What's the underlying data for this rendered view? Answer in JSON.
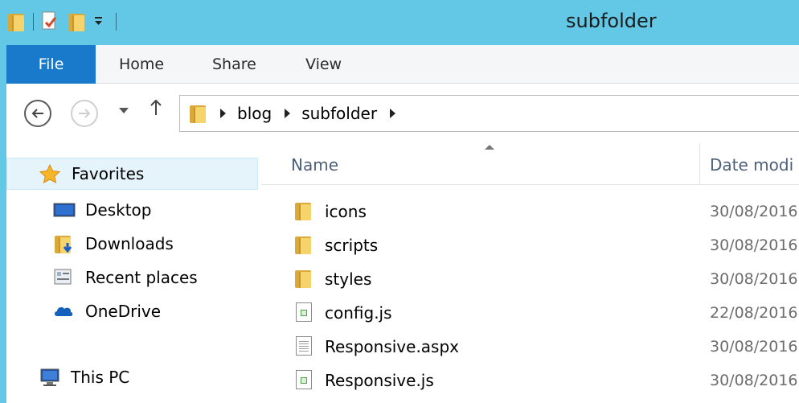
{
  "window": {
    "title": "subfolder",
    "accent_color": "#62c8e6",
    "file_tab_color": "#1979ca"
  },
  "quick_access_toolbar": {
    "icons": [
      "folder-icon",
      "properties-icon",
      "new-folder-icon",
      "customize-dropdown-icon"
    ]
  },
  "ribbon": {
    "tabs": [
      "File",
      "Home",
      "Share",
      "View"
    ]
  },
  "navigation": {
    "back_icon": "back-arrow-icon",
    "forward_icon": "forward-arrow-icon",
    "up_icon": "up-arrow-icon",
    "breadcrumbs": [
      "blog",
      "subfolder"
    ]
  },
  "nav_pane": {
    "favorites_label": "Favorites",
    "items": [
      "Desktop",
      "Downloads",
      "Recent places",
      "OneDrive"
    ],
    "this_pc_label": "This PC"
  },
  "file_list": {
    "columns": {
      "name": "Name",
      "date": "Date modi"
    },
    "rows": [
      {
        "name": "icons",
        "type": "folder",
        "date": "30/08/2016"
      },
      {
        "name": "scripts",
        "type": "folder",
        "date": "30/08/2016"
      },
      {
        "name": "styles",
        "type": "folder",
        "date": "30/08/2016"
      },
      {
        "name": "config.js",
        "type": "js",
        "date": "22/08/2016"
      },
      {
        "name": "Responsive.aspx",
        "type": "aspx",
        "date": "30/08/2016"
      },
      {
        "name": "Responsive.js",
        "type": "js",
        "date": "30/08/2016"
      }
    ]
  }
}
